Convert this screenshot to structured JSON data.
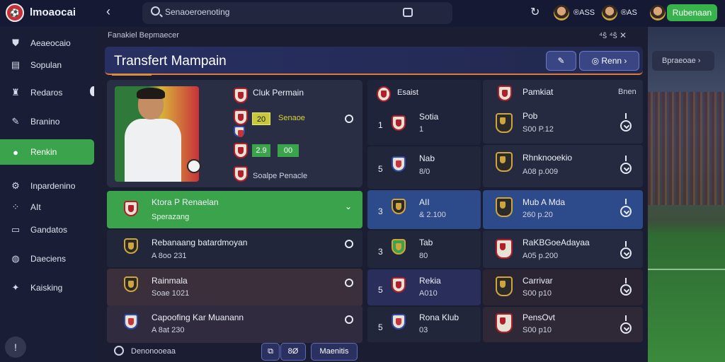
{
  "app": {
    "title": "lmoaocai",
    "logo_text": "⚽"
  },
  "topbar": {
    "search_placeholder": "Senaoeroenoting",
    "stat1": "®ASS",
    "stat2": "®AS",
    "button": "Rubenaan"
  },
  "sidebar": {
    "items": [
      {
        "label": "Aeaeocaio",
        "icon": "shield-icon"
      },
      {
        "label": "Sopulan",
        "icon": "calendar-icon"
      },
      {
        "label": "Redaros",
        "icon": "trophy-icon"
      },
      {
        "label": "Branino",
        "icon": "brush-icon"
      },
      {
        "label": "Renkin",
        "icon": "users-icon",
        "active": true
      },
      {
        "label": "Inpardenino",
        "icon": "gear-icon"
      },
      {
        "label": "AIt",
        "icon": "grid-icon"
      },
      {
        "label": "Gandatos",
        "icon": "cards-icon"
      },
      {
        "label": "Daeciens",
        "icon": "globe-icon"
      },
      {
        "label": "Kaisking",
        "icon": "chart-icon"
      }
    ],
    "help": "!"
  },
  "main": {
    "breadcrumb": "Fanakiel  Bepmaecer",
    "window_controls": "⁴ŝ  ⁴ŝ  ✕",
    "title": "Transfert Mampain",
    "btn_edit": "✎",
    "btn_action": "Renn",
    "side_card": "Bpraeoae"
  },
  "player": {
    "club": "Cluk Permain",
    "badge1": "20",
    "pos": "Senaoe",
    "badge2": "2.9",
    "badge3": "00",
    "foot": "Soalpe Penacle"
  },
  "left_list": [
    {
      "name": "Ktora P Renaelan",
      "sub": "Sperazang",
      "active": true
    },
    {
      "name": "Rebanaang batardmoyan",
      "sub": "A 8oo 231"
    },
    {
      "name": "Rainmala",
      "sub": "Soae 1021"
    },
    {
      "name": "Capoofing Kar Muanann",
      "sub": "A 8at 230"
    }
  ],
  "mid_list": {
    "header": "Esaist",
    "rows": [
      {
        "num": "1",
        "name": "Sotia",
        "sub": "1"
      },
      {
        "num": "5",
        "name": "Nab",
        "sub": "8/0"
      },
      {
        "num": "3",
        "name": "AII",
        "sub": "& 2.100",
        "active": true
      },
      {
        "num": "3",
        "name": "Tab",
        "sub": "80"
      },
      {
        "num": "5",
        "name": "Rekia",
        "sub": "A010"
      },
      {
        "num": "5",
        "name": "Rona Klub",
        "sub": "03"
      }
    ]
  },
  "right_list": {
    "header_name": "Pamkiat",
    "header_tag": "Bnen",
    "rows": [
      {
        "name": "Pob",
        "sub": "S00 P.12"
      },
      {
        "name": "Rhnknooekio",
        "sub": "A08 p.009"
      },
      {
        "name": "Mub A Mda",
        "sub": "260 p.20",
        "active": true
      },
      {
        "name": "RaKBGoeAdayaa",
        "sub": "A05 p.200"
      },
      {
        "name": "Carrivar",
        "sub": "S00 p10"
      },
      {
        "name": "PensOvt",
        "sub": "S00 p10"
      }
    ]
  },
  "footer": {
    "label": "Denonooeaa",
    "btn1": "⧉",
    "btn2": "8Ø",
    "btn3": "Maenitis"
  },
  "colors": {
    "accent_green": "#3aa34c",
    "header_blue": "#283063",
    "active_blue": "#2d4a8a"
  }
}
